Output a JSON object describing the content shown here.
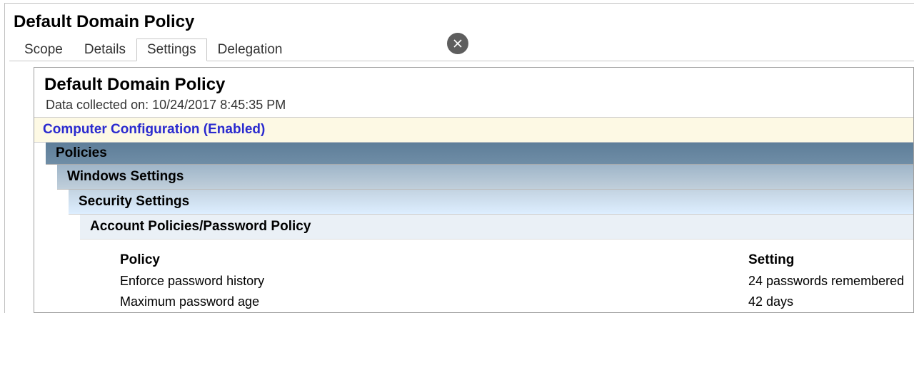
{
  "window": {
    "title": "Default Domain Policy"
  },
  "tabs": {
    "scope": "Scope",
    "details": "Details",
    "settings": "Settings",
    "delegation": "Delegation"
  },
  "report": {
    "title": "Default Domain Policy",
    "collected_label": "Data collected on:",
    "collected_value": "10/24/2017 8:45:35 PM"
  },
  "sections": {
    "computer_config": "Computer Configuration (Enabled)",
    "policies": "Policies",
    "windows_settings": "Windows Settings",
    "security_settings": "Security Settings",
    "account_policies": "Account Policies/Password Policy"
  },
  "table": {
    "header_policy": "Policy",
    "header_setting": "Setting",
    "rows": [
      {
        "policy": "Enforce password history",
        "setting": "24 passwords remembered"
      },
      {
        "policy": "Maximum password age",
        "setting": "42 days"
      }
    ]
  }
}
